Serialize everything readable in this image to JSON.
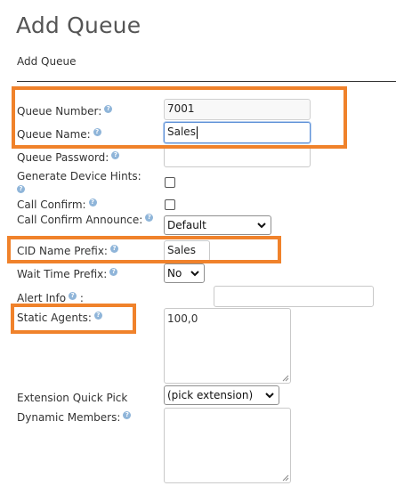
{
  "page": {
    "title": "Add Queue",
    "section_tab": "Add Queue"
  },
  "form": {
    "queue_number": {
      "label": "Queue Number:",
      "value": "7001"
    },
    "queue_name": {
      "label": "Queue Name:",
      "value": "Sales"
    },
    "queue_password": {
      "label": "Queue Password:",
      "value": ""
    },
    "generate_device_hints": {
      "label": "Generate Device Hints:",
      "checked": false
    },
    "call_confirm": {
      "label": "Call Confirm:",
      "checked": false
    },
    "call_confirm_announce": {
      "label": "Call Confirm Announce:",
      "value": "Default"
    },
    "cid_name_prefix": {
      "label": "CID Name Prefix:",
      "value": "Sales"
    },
    "wait_time_prefix": {
      "label": "Wait Time Prefix:",
      "value": "No"
    },
    "alert_info": {
      "label": "Alert Info",
      "suffix": ":",
      "value": ""
    },
    "static_agents": {
      "label": "Static Agents:",
      "value": "100,0"
    },
    "extension_quick_pick": {
      "label": "Extension Quick Pick",
      "value": "(pick extension)"
    },
    "dynamic_members": {
      "label": "Dynamic Members:",
      "value": ""
    }
  },
  "icons": {
    "help": "question-mark-icon",
    "select_arrow": "chevron-down-icon",
    "resize": "resize-grip-icon"
  },
  "colors": {
    "highlight": "#f0822b",
    "focus_border": "#5a8ed6",
    "help_icon": "#8fb5d9",
    "title": "#555555"
  }
}
